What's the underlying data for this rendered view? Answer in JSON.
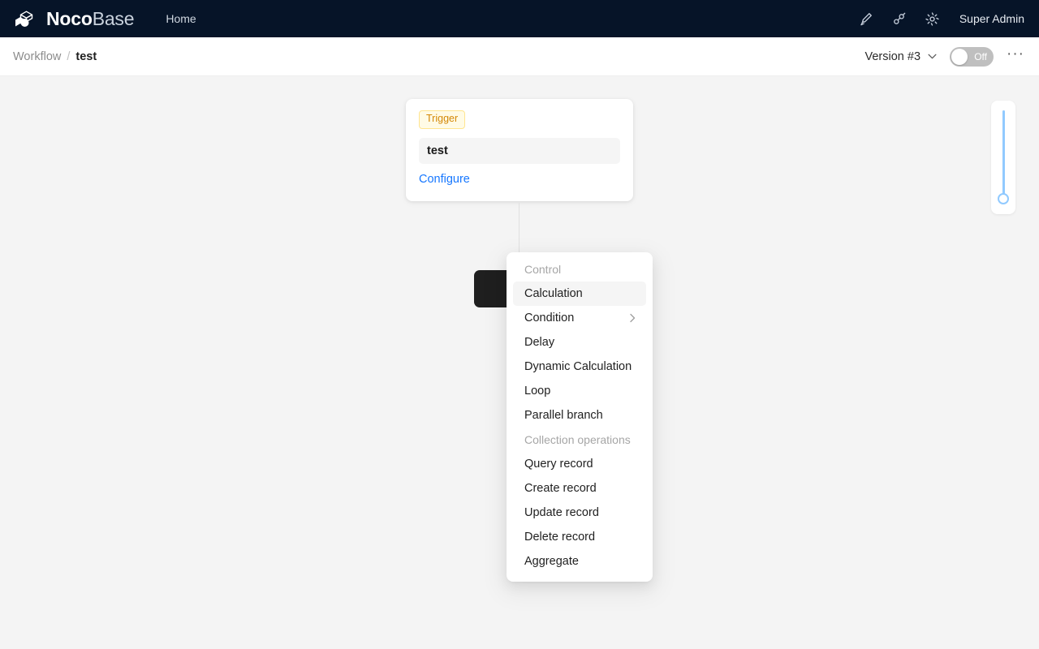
{
  "header": {
    "brand_bold": "Noco",
    "brand_light": "Base",
    "nav": [
      {
        "label": "Home",
        "name": "nav-home"
      }
    ],
    "icons": [
      {
        "name": "highlighter-icon",
        "title": "UI Editor"
      },
      {
        "name": "api-plugin-icon",
        "title": "Plugin manager"
      },
      {
        "name": "gear-icon",
        "title": "Settings"
      }
    ],
    "user": "Super Admin",
    "bg_color": "#061428"
  },
  "subheader": {
    "breadcrumb": {
      "parent": "Workflow",
      "separator": "/",
      "current": "test"
    },
    "version_label": "Version  #3",
    "toggle": {
      "state_label": "Off",
      "enabled": false,
      "off_color": "#bfbfbf"
    },
    "more_label": "···"
  },
  "canvas": {
    "trigger_node": {
      "tag": "Trigger",
      "title": "test",
      "configure_link": "Configure",
      "tag_bg": "#fffbe6",
      "tag_border": "#ffe58f",
      "tag_color": "#d48806",
      "link_color": "#1677ff"
    },
    "add_button": {
      "name": "add-node-button",
      "glyph": "+"
    },
    "menu": {
      "groups": [
        {
          "label": "Control",
          "items": [
            {
              "label": "Calculation",
              "active": true,
              "has_submenu": false
            },
            {
              "label": "Condition",
              "active": false,
              "has_submenu": true
            },
            {
              "label": "Delay",
              "active": false,
              "has_submenu": false
            },
            {
              "label": "Dynamic Calculation",
              "active": false,
              "has_submenu": false
            },
            {
              "label": "Loop",
              "active": false,
              "has_submenu": false
            },
            {
              "label": "Parallel branch",
              "active": false,
              "has_submenu": false
            }
          ]
        },
        {
          "label": "Collection operations",
          "items": [
            {
              "label": "Query record",
              "active": false,
              "has_submenu": false
            },
            {
              "label": "Create record",
              "active": false,
              "has_submenu": false
            },
            {
              "label": "Update record",
              "active": false,
              "has_submenu": false
            },
            {
              "label": "Delete record",
              "active": false,
              "has_submenu": false
            },
            {
              "label": "Aggregate",
              "active": false,
              "has_submenu": false
            }
          ]
        }
      ],
      "highlight_bg": "#f5f5f5"
    },
    "zoom_slider": {
      "name": "zoom-slider",
      "track_color": "#91caff",
      "value_position": "bottom"
    },
    "background_color": "#f4f4f4"
  }
}
